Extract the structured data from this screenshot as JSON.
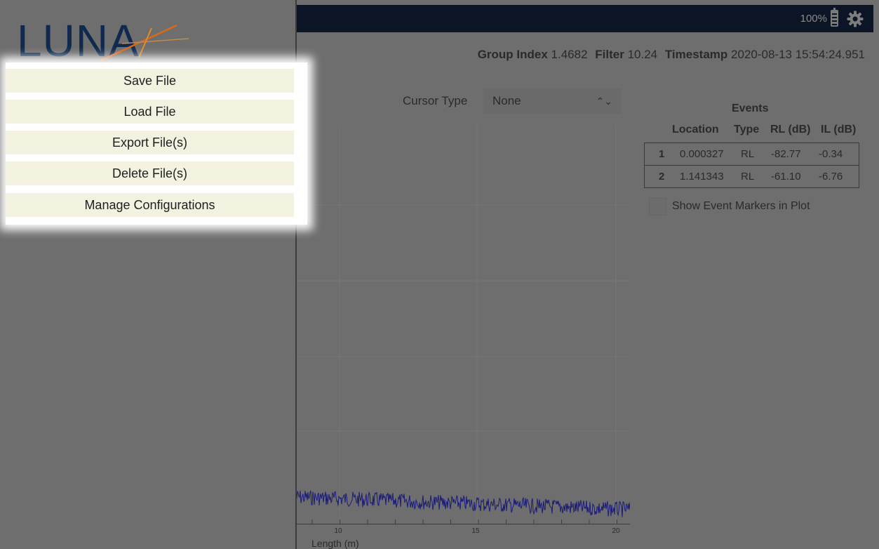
{
  "menu": {
    "items": [
      {
        "label": "Save File"
      },
      {
        "label": "Load File"
      },
      {
        "label": "Export File(s)"
      },
      {
        "label": "Delete File(s)"
      },
      {
        "label": "Manage Configurations"
      }
    ]
  },
  "logo": {
    "text": "LUNA"
  },
  "status": {
    "battery": "100%"
  },
  "info": {
    "group_index_label": "Group Index",
    "group_index_value": "1.4682",
    "filter_label": "Filter",
    "filter_value": "10.24",
    "timestamp_label": "Timestamp",
    "timestamp_value": "2020-08-13 15:54:24.951"
  },
  "cursor": {
    "label": "Cursor Type",
    "value": "None"
  },
  "events": {
    "title": "Events",
    "headers": [
      "Location",
      "Type",
      "RL (dB)",
      "IL (dB)"
    ],
    "rows": [
      {
        "num": "1",
        "location": "0.000327",
        "type": "RL",
        "rl": "-82.77",
        "il": "-0.34"
      },
      {
        "num": "2",
        "location": "1.141343",
        "type": "RL",
        "rl": "-61.10",
        "il": "-6.76"
      }
    ],
    "show_markers_label": "Show Event Markers in Plot",
    "show_markers_checked": false
  },
  "plot": {
    "xlabel": "Length (m)",
    "x_ticks": [
      "10",
      "15",
      "20"
    ]
  },
  "colors": {
    "topbar": "#0c1526",
    "menu_item_bg": "#f3f2e1",
    "trace": "#1a1a7a",
    "logo_blue": "#0f2a4e",
    "logo_orange": "#d86a1a"
  }
}
